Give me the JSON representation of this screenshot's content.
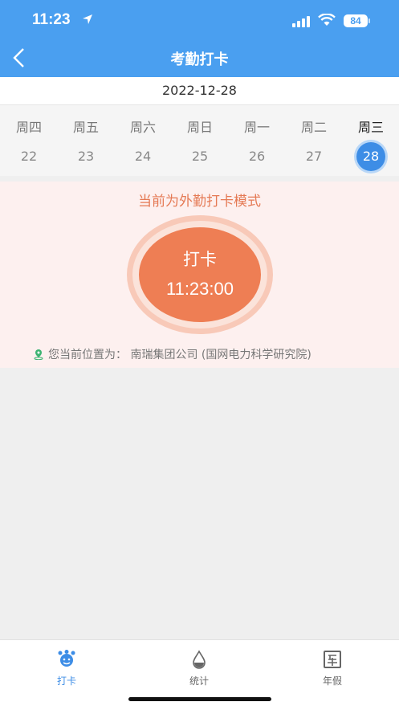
{
  "status_bar": {
    "time": "11:23",
    "battery": "84"
  },
  "header": {
    "title": "考勤打卡"
  },
  "date": "2022-12-28",
  "week": [
    {
      "weekday": "周四",
      "date": "22"
    },
    {
      "weekday": "周五",
      "date": "23"
    },
    {
      "weekday": "周六",
      "date": "24"
    },
    {
      "weekday": "周日",
      "date": "25"
    },
    {
      "weekday": "周一",
      "date": "26"
    },
    {
      "weekday": "周二",
      "date": "27"
    },
    {
      "weekday": "周三",
      "date": "28"
    }
  ],
  "punch": {
    "mode_text": "当前为外勤打卡模式",
    "button_label": "打卡",
    "time": "11:23:00",
    "location_text": "您当前位置为： 南瑞集团公司 (国网电力科学研究院)"
  },
  "tabs": [
    {
      "label": "打卡",
      "icon": "punch-icon"
    },
    {
      "label": "统计",
      "icon": "stats-icon"
    },
    {
      "label": "年假",
      "icon": "annual-leave-icon"
    }
  ],
  "colors": {
    "header_blue": "#4a9ff0",
    "accent_orange": "#ee7e54",
    "selected_blue": "#3d8de6"
  }
}
